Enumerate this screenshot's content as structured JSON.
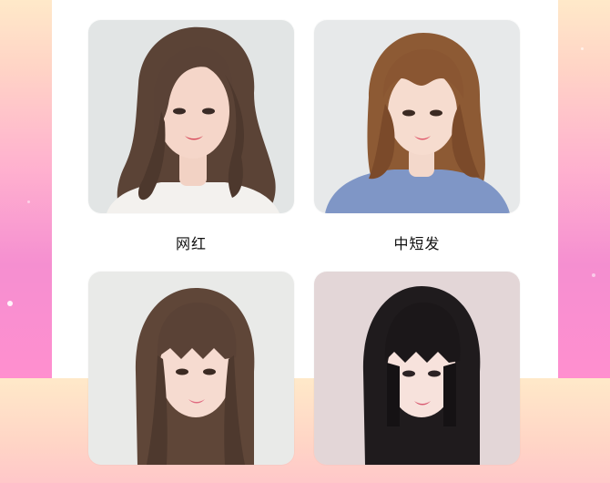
{
  "hairstyles": [
    {
      "label": "网红"
    },
    {
      "label": "中短发"
    },
    {
      "label": ""
    },
    {
      "label": ""
    }
  ],
  "colors": {
    "background_top": "#ffe9c9",
    "background_bottom": "#ff8fcf",
    "card": "#ffffff",
    "caption_text": "#111111"
  }
}
